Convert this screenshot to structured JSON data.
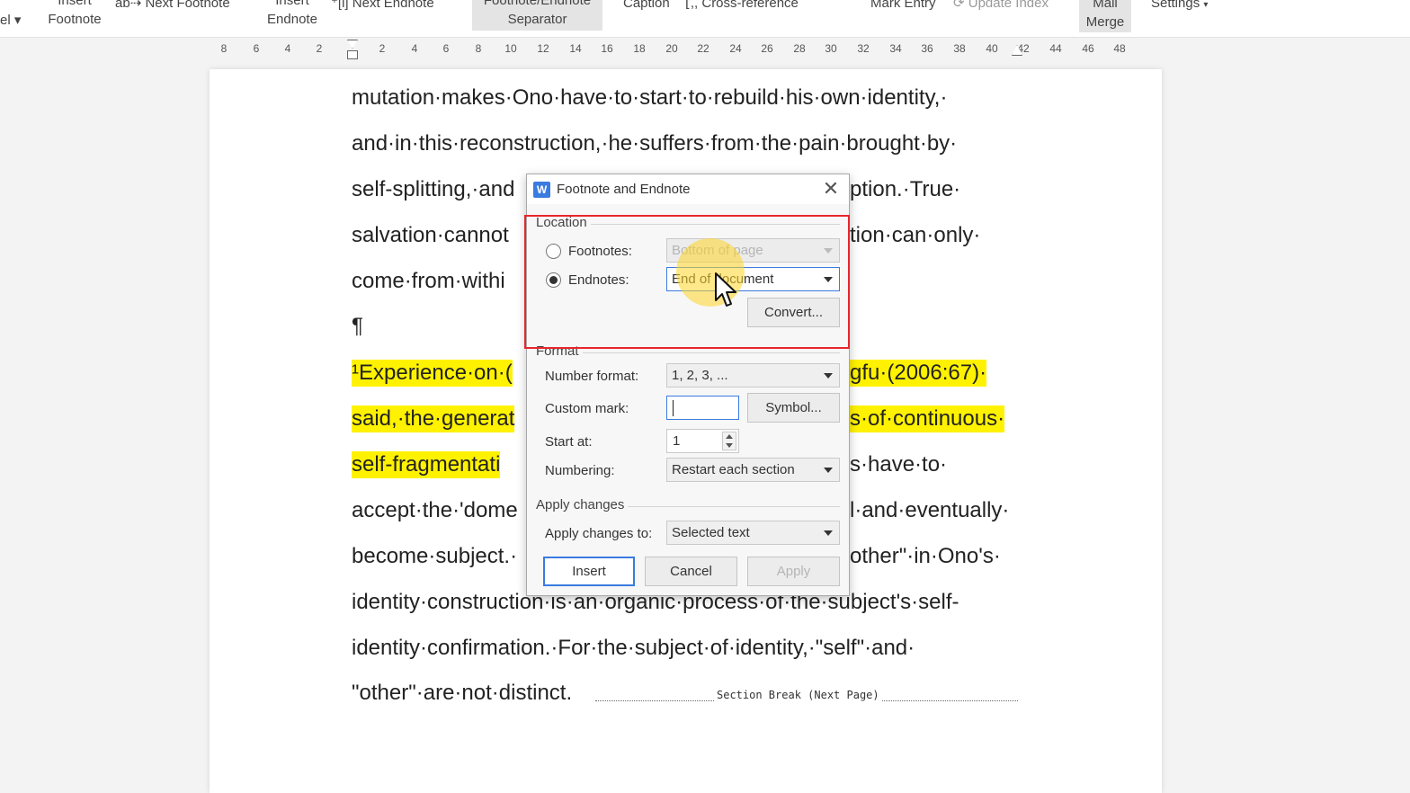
{
  "ribbon": {
    "insert_footnote": [
      "Insert",
      "Footnote"
    ],
    "next_footnote": "Next Footnote",
    "insert_endnote": [
      "Insert",
      "Endnote"
    ],
    "next_endnote": "Next Endnote",
    "separator": [
      "Footnote/Endnote",
      "Separator"
    ],
    "caption": "Caption",
    "cross_reference": "Cross-reference",
    "mark_entry": "Mark Entry",
    "update_index": "Update Index",
    "mail_merge": [
      "Mail",
      "Merge"
    ],
    "settings": "Settings",
    "left_fragment": "el"
  },
  "ruler": {
    "ticks": [
      "8",
      "6",
      "4",
      "2",
      "2",
      "4",
      "6",
      "8",
      "10",
      "12",
      "14",
      "16",
      "18",
      "20",
      "22",
      "24",
      "26",
      "28",
      "30",
      "32",
      "34",
      "36",
      "38",
      "40",
      "42",
      "44",
      "46",
      "48"
    ]
  },
  "document": {
    "lines": [
      "mutation·makes·Ono·have·to·start·to·rebuild·his·own·identity,·",
      "and·in·this·reconstruction,·he·suffers·from·the·pain·brought·by·",
      "self-splitting,·and",
      "ption.·True·",
      "salvation·cannot",
      "tion·can·only·",
      "come·from·withi",
      "¶",
      "¹Experience·on·(",
      "gfu·(2006:67)·",
      "said,·the·generat",
      "s·of·continuous·",
      "self-fragmentati",
      "s·have·to·",
      "accept·the·'dome",
      "l·and·eventually·",
      "become·subject.·",
      "other\"·in·Ono's·",
      "identity·construction·is·an·organic·process·of·the·subject's·self-",
      "identity·confirmation.·For·the·subject·of·identity,·\"self\"·and·",
      "\"other\"·are·not·distinct."
    ],
    "section_break": "Section Break (Next Page)"
  },
  "dialog": {
    "title": "Footnote and Endnote",
    "location_label": "Location",
    "footnotes_label": "Footnotes:",
    "footnotes_value": "Bottom of page",
    "endnotes_label": "Endnotes:",
    "endnotes_value": "End of document",
    "convert_label": "Convert...",
    "format_label": "Format",
    "number_format_label": "Number format:",
    "number_format_value": "1, 2, 3, ...",
    "custom_mark_label": "Custom mark:",
    "symbol_label": "Symbol...",
    "start_at_label": "Start at:",
    "start_at_value": "1",
    "numbering_label": "Numbering:",
    "numbering_value": "Restart each section",
    "apply_changes_label": "Apply changes",
    "apply_changes_to_label": "Apply changes to:",
    "apply_changes_to_value": "Selected text",
    "insert_label": "Insert",
    "cancel_label": "Cancel",
    "apply_label": "Apply",
    "selected_location": "Endnotes"
  },
  "colors": {
    "accent": "#3a7be0",
    "highlight": "#fff200",
    "annotation_box": "#e8262c",
    "cursor_highlight": "#ffd628"
  }
}
